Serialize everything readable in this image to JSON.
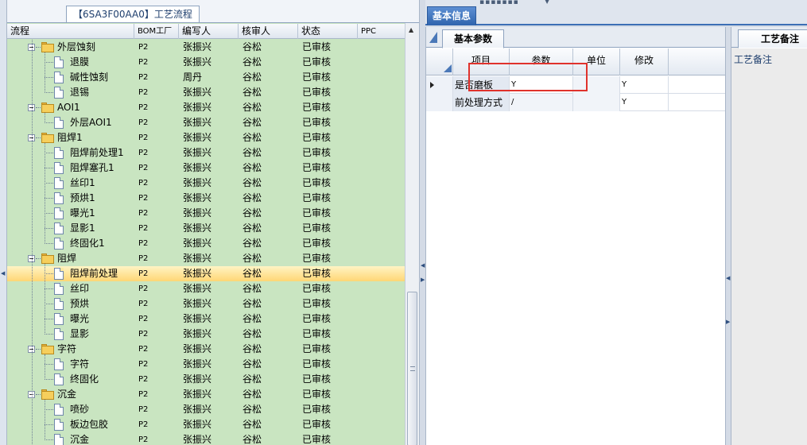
{
  "left_tab": {
    "title": "【6SA3F00AA0】工艺流程"
  },
  "tree": {
    "columns": {
      "process": "流程",
      "bom_factory": "BOM工厂",
      "writer": "编写人",
      "reviewer": "核审人",
      "status": "状态",
      "ppc": "PPC"
    },
    "rows": [
      {
        "name": "外层蚀刻",
        "type": "folder",
        "bom": "P2",
        "writer": "张振兴",
        "reviewer": "谷松",
        "status": "已审核"
      },
      {
        "name": "退膜",
        "type": "doc",
        "bom": "P2",
        "writer": "张振兴",
        "reviewer": "谷松",
        "status": "已审核"
      },
      {
        "name": "碱性蚀刻",
        "type": "doc",
        "bom": "P2",
        "writer": "周丹",
        "reviewer": "谷松",
        "status": "已审核"
      },
      {
        "name": "退锡",
        "type": "doc",
        "bom": "P2",
        "writer": "张振兴",
        "reviewer": "谷松",
        "status": "已审核"
      },
      {
        "name": "AOI1",
        "type": "folder",
        "bom": "P2",
        "writer": "张振兴",
        "reviewer": "谷松",
        "status": "已审核"
      },
      {
        "name": "外层AOI1",
        "type": "doc",
        "bom": "P2",
        "writer": "张振兴",
        "reviewer": "谷松",
        "status": "已审核"
      },
      {
        "name": "阻焊1",
        "type": "folder",
        "bom": "P2",
        "writer": "张振兴",
        "reviewer": "谷松",
        "status": "已审核"
      },
      {
        "name": "阻焊前处理1",
        "type": "doc",
        "bom": "P2",
        "writer": "张振兴",
        "reviewer": "谷松",
        "status": "已审核"
      },
      {
        "name": "阻焊塞孔1",
        "type": "doc",
        "bom": "P2",
        "writer": "张振兴",
        "reviewer": "谷松",
        "status": "已审核"
      },
      {
        "name": "丝印1",
        "type": "doc",
        "bom": "P2",
        "writer": "张振兴",
        "reviewer": "谷松",
        "status": "已审核"
      },
      {
        "name": "预烘1",
        "type": "doc",
        "bom": "P2",
        "writer": "张振兴",
        "reviewer": "谷松",
        "status": "已审核"
      },
      {
        "name": "曝光1",
        "type": "doc",
        "bom": "P2",
        "writer": "张振兴",
        "reviewer": "谷松",
        "status": "已审核"
      },
      {
        "name": "显影1",
        "type": "doc",
        "bom": "P2",
        "writer": "张振兴",
        "reviewer": "谷松",
        "status": "已审核"
      },
      {
        "name": "终固化1",
        "type": "doc",
        "bom": "P2",
        "writer": "张振兴",
        "reviewer": "谷松",
        "status": "已审核"
      },
      {
        "name": "阻焊",
        "type": "folder",
        "bom": "P2",
        "writer": "张振兴",
        "reviewer": "谷松",
        "status": "已审核"
      },
      {
        "name": "阻焊前处理",
        "type": "doc",
        "bom": "P2",
        "writer": "张振兴",
        "reviewer": "谷松",
        "status": "已审核"
      },
      {
        "name": "丝印",
        "type": "doc",
        "bom": "P2",
        "writer": "张振兴",
        "reviewer": "谷松",
        "status": "已审核"
      },
      {
        "name": "预烘",
        "type": "doc",
        "bom": "P2",
        "writer": "张振兴",
        "reviewer": "谷松",
        "status": "已审核"
      },
      {
        "name": "曝光",
        "type": "doc",
        "bom": "P2",
        "writer": "张振兴",
        "reviewer": "谷松",
        "status": "已审核"
      },
      {
        "name": "显影",
        "type": "doc",
        "bom": "P2",
        "writer": "张振兴",
        "reviewer": "谷松",
        "status": "已审核"
      },
      {
        "name": "字符",
        "type": "folder",
        "bom": "P2",
        "writer": "张振兴",
        "reviewer": "谷松",
        "status": "已审核"
      },
      {
        "name": "字符",
        "type": "doc",
        "bom": "P2",
        "writer": "张振兴",
        "reviewer": "谷松",
        "status": "已审核"
      },
      {
        "name": "终固化",
        "type": "doc",
        "bom": "P2",
        "writer": "张振兴",
        "reviewer": "谷松",
        "status": "已审核"
      },
      {
        "name": "沉金",
        "type": "folder",
        "bom": "P2",
        "writer": "张振兴",
        "reviewer": "谷松",
        "status": "已审核"
      },
      {
        "name": "喷砂",
        "type": "doc",
        "bom": "P2",
        "writer": "张振兴",
        "reviewer": "谷松",
        "status": "已审核"
      },
      {
        "name": "板边包胶",
        "type": "doc",
        "bom": "P2",
        "writer": "张振兴",
        "reviewer": "谷松",
        "status": "已审核"
      },
      {
        "name": "沉金",
        "type": "doc",
        "bom": "P2",
        "writer": "张振兴",
        "reviewer": "谷松",
        "status": "已审核"
      }
    ],
    "selected_row": "阻焊前处理"
  },
  "main_tab": {
    "label": "基本信息"
  },
  "params": {
    "subtab_label": "基本参数",
    "columns": {
      "item": "项目",
      "param": "参数",
      "unit": "单位",
      "modify": "修改"
    },
    "rows": [
      {
        "item": "是否磨板",
        "param": "Y",
        "unit": "",
        "modify": "Y"
      },
      {
        "item": "前处理方式",
        "param": "/",
        "unit": "",
        "modify": "Y"
      }
    ]
  },
  "notes": {
    "tab_label": "工艺备注",
    "label": "工艺备注"
  },
  "colors": {
    "tree_bg": "#c9e5c1",
    "selection": "#ffd675",
    "tab_active": "#2f64ad",
    "highlight_box": "#e0322c"
  }
}
